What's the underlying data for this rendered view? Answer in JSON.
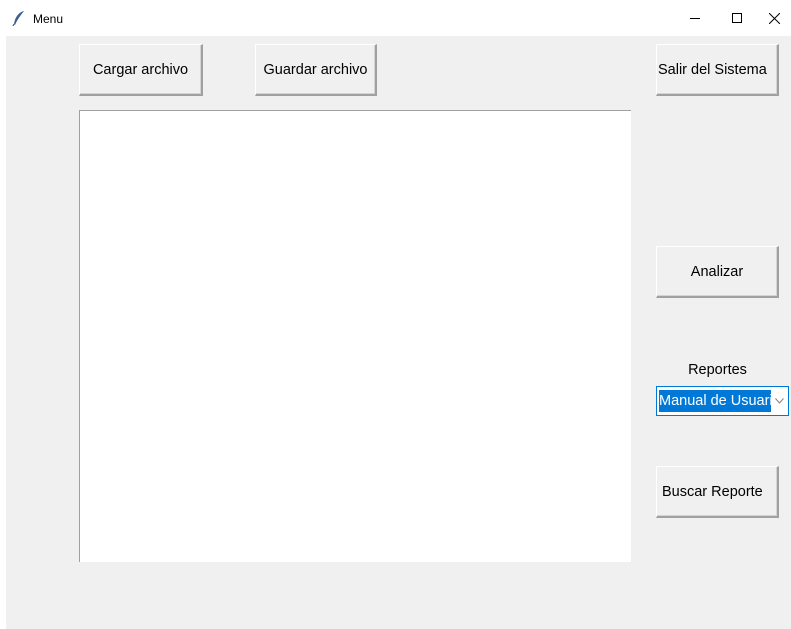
{
  "window": {
    "title": "Menu",
    "icon": "feather-icon",
    "controls": {
      "minimize": "minimize-icon",
      "maximize": "maximize-icon",
      "close": "close-icon"
    }
  },
  "toolbar": {
    "load_label": "Cargar archivo",
    "save_label": "Guardar archivo",
    "exit_label": "Salir del Sistema"
  },
  "editor": {
    "content": ""
  },
  "side": {
    "analyze_label": "Analizar",
    "reports_label": "Reportes",
    "reports_selected": "Manual de Usuario",
    "search_report_label": "Buscar Reporte"
  },
  "colors": {
    "accent": "#0078d7",
    "background": "#f0f0f0"
  }
}
